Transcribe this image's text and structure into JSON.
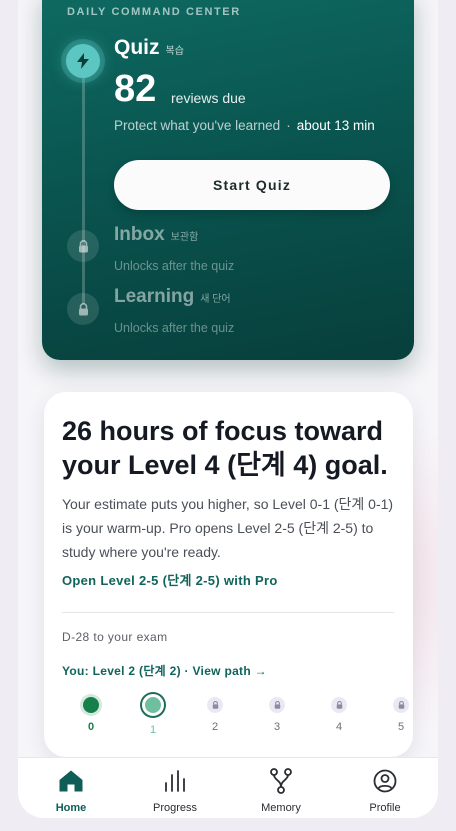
{
  "command_center": {
    "eyebrow": "DAILY COMMAND CENTER",
    "quiz": {
      "title": "Quiz",
      "title_ko": "복습",
      "count": "82",
      "count_label": "reviews due",
      "subtitle": "Protect what you've learned",
      "separator": "·",
      "time": "about 13 min",
      "button": "Start Quiz",
      "icon": "lightning-icon"
    },
    "inbox": {
      "title": "Inbox",
      "title_ko": "보관함",
      "status": "Unlocks after the quiz",
      "icon": "lock-icon"
    },
    "learning": {
      "title": "Learning",
      "title_ko": "새 단어",
      "status": "Unlocks after the quiz",
      "icon": "lock-icon"
    }
  },
  "focus_card": {
    "title": "26 hours of focus toward your Level 4 (단계 4) goal.",
    "body": "Your estimate puts you higher, so Level 0-1 (단계 0-1) is your warm-up. Pro opens Level 2-5 (단계 2-5) to study where you're ready.",
    "pro_link": "Open Level 2-5 (단계 2-5) with Pro",
    "exam": "D-28 to your exam",
    "path_link": "You: Level 2 (단계 2) · View path →",
    "levels": [
      {
        "label": "0",
        "state": "done"
      },
      {
        "label": "1",
        "state": "current"
      },
      {
        "label": "2",
        "state": "locked"
      },
      {
        "label": "3",
        "state": "locked"
      },
      {
        "label": "4",
        "state": "locked"
      },
      {
        "label": "5",
        "state": "locked"
      }
    ]
  },
  "tabbar": {
    "tabs": [
      {
        "label": "Home",
        "icon": "home-icon",
        "active": true
      },
      {
        "label": "Progress",
        "icon": "bar-chart-icon",
        "active": false
      },
      {
        "label": "Memory",
        "icon": "branch-icon",
        "active": false
      },
      {
        "label": "Profile",
        "icon": "user-circle-icon",
        "active": false
      }
    ]
  },
  "colors": {
    "accent": "#0f5d56",
    "panel_top": "#0e6a62",
    "panel_bottom": "#073f3c",
    "level_done": "#17804a",
    "level_current": "#6fbf9f"
  }
}
